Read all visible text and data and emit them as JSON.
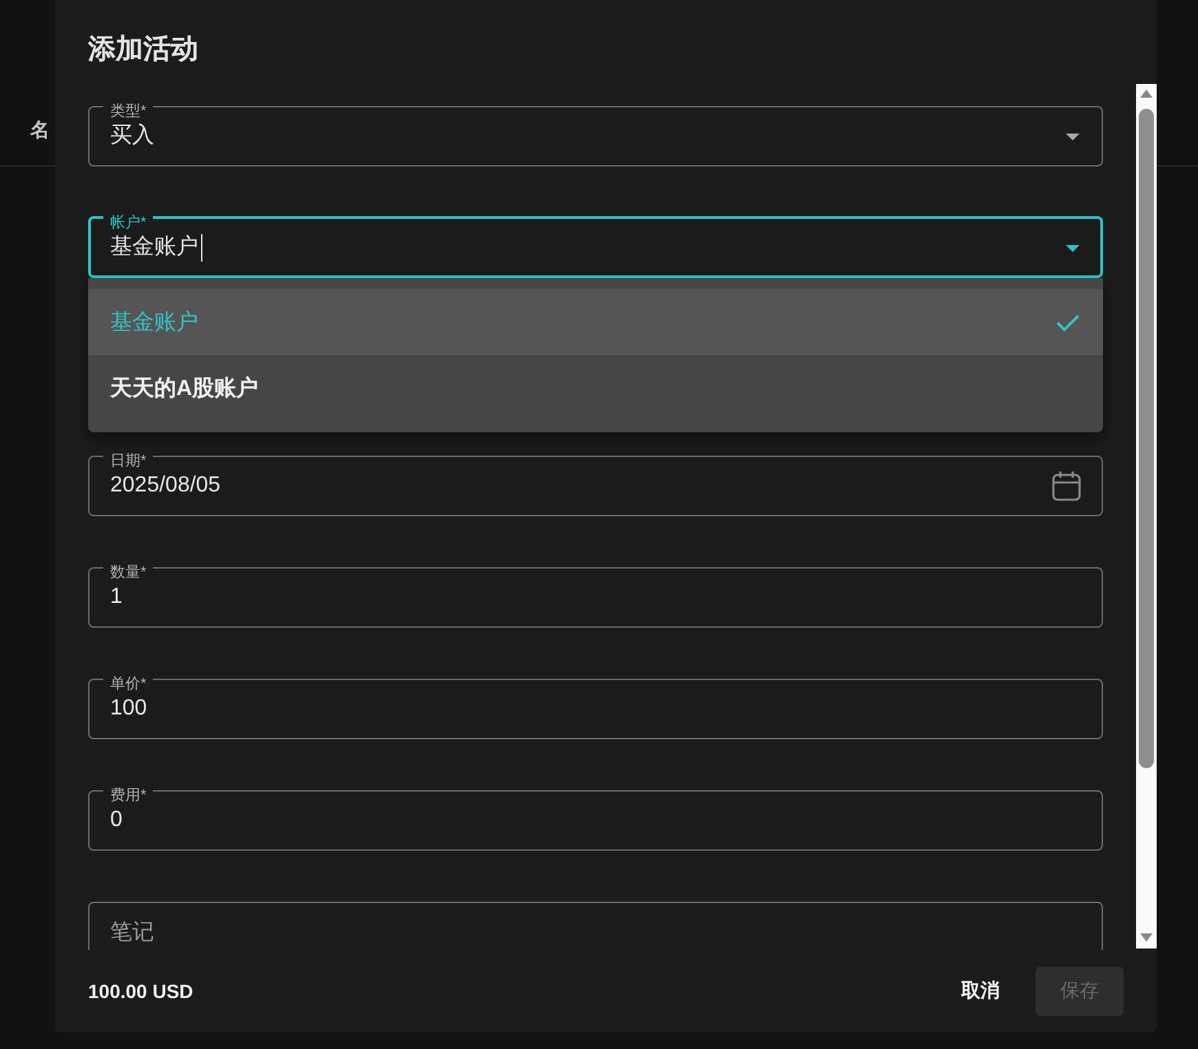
{
  "backdrop": {
    "column_header": "名"
  },
  "dialog": {
    "title": "添加活动",
    "fields": [
      {
        "kind": "select",
        "label": "类型*",
        "value": "买入",
        "focused": false
      },
      {
        "kind": "select",
        "label": "帐户*",
        "value": "基金账户",
        "focused": true,
        "menu": {
          "options": [
            {
              "label": "基金账户",
              "selected": true
            },
            {
              "label": "天天的A股账户",
              "selected": false
            }
          ]
        }
      },
      {
        "kind": "date",
        "label": "日期*",
        "value": "2025/08/05",
        "focused": false
      },
      {
        "kind": "text",
        "label": "数量*",
        "value": "1",
        "focused": false
      },
      {
        "kind": "text",
        "label": "单价*",
        "value": "100",
        "focused": false
      },
      {
        "kind": "text",
        "label": "费用*",
        "value": "0",
        "focused": false
      },
      {
        "kind": "text",
        "placeholder": "笔记",
        "focused": false
      }
    ],
    "footer": {
      "total": "100.00 USD",
      "buttons": [
        {
          "kind": "text",
          "label": "取消",
          "disabled": false
        },
        {
          "kind": "contained",
          "label": "保存",
          "disabled": true
        }
      ]
    }
  }
}
